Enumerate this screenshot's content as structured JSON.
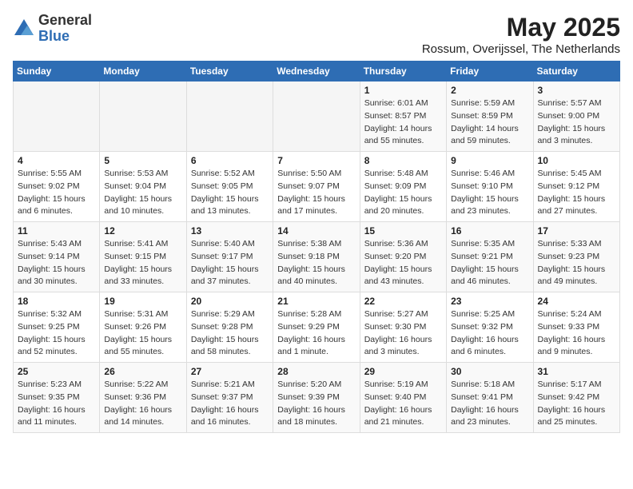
{
  "logo": {
    "general": "General",
    "blue": "Blue"
  },
  "title": {
    "month": "May 2025",
    "location": "Rossum, Overijssel, The Netherlands"
  },
  "days_of_week": [
    "Sunday",
    "Monday",
    "Tuesday",
    "Wednesday",
    "Thursday",
    "Friday",
    "Saturday"
  ],
  "weeks": [
    [
      {
        "day": "",
        "info": ""
      },
      {
        "day": "",
        "info": ""
      },
      {
        "day": "",
        "info": ""
      },
      {
        "day": "",
        "info": ""
      },
      {
        "day": "1",
        "info": "Sunrise: 6:01 AM\nSunset: 8:57 PM\nDaylight: 14 hours\nand 55 minutes."
      },
      {
        "day": "2",
        "info": "Sunrise: 5:59 AM\nSunset: 8:59 PM\nDaylight: 14 hours\nand 59 minutes."
      },
      {
        "day": "3",
        "info": "Sunrise: 5:57 AM\nSunset: 9:00 PM\nDaylight: 15 hours\nand 3 minutes."
      }
    ],
    [
      {
        "day": "4",
        "info": "Sunrise: 5:55 AM\nSunset: 9:02 PM\nDaylight: 15 hours\nand 6 minutes."
      },
      {
        "day": "5",
        "info": "Sunrise: 5:53 AM\nSunset: 9:04 PM\nDaylight: 15 hours\nand 10 minutes."
      },
      {
        "day": "6",
        "info": "Sunrise: 5:52 AM\nSunset: 9:05 PM\nDaylight: 15 hours\nand 13 minutes."
      },
      {
        "day": "7",
        "info": "Sunrise: 5:50 AM\nSunset: 9:07 PM\nDaylight: 15 hours\nand 17 minutes."
      },
      {
        "day": "8",
        "info": "Sunrise: 5:48 AM\nSunset: 9:09 PM\nDaylight: 15 hours\nand 20 minutes."
      },
      {
        "day": "9",
        "info": "Sunrise: 5:46 AM\nSunset: 9:10 PM\nDaylight: 15 hours\nand 23 minutes."
      },
      {
        "day": "10",
        "info": "Sunrise: 5:45 AM\nSunset: 9:12 PM\nDaylight: 15 hours\nand 27 minutes."
      }
    ],
    [
      {
        "day": "11",
        "info": "Sunrise: 5:43 AM\nSunset: 9:14 PM\nDaylight: 15 hours\nand 30 minutes."
      },
      {
        "day": "12",
        "info": "Sunrise: 5:41 AM\nSunset: 9:15 PM\nDaylight: 15 hours\nand 33 minutes."
      },
      {
        "day": "13",
        "info": "Sunrise: 5:40 AM\nSunset: 9:17 PM\nDaylight: 15 hours\nand 37 minutes."
      },
      {
        "day": "14",
        "info": "Sunrise: 5:38 AM\nSunset: 9:18 PM\nDaylight: 15 hours\nand 40 minutes."
      },
      {
        "day": "15",
        "info": "Sunrise: 5:36 AM\nSunset: 9:20 PM\nDaylight: 15 hours\nand 43 minutes."
      },
      {
        "day": "16",
        "info": "Sunrise: 5:35 AM\nSunset: 9:21 PM\nDaylight: 15 hours\nand 46 minutes."
      },
      {
        "day": "17",
        "info": "Sunrise: 5:33 AM\nSunset: 9:23 PM\nDaylight: 15 hours\nand 49 minutes."
      }
    ],
    [
      {
        "day": "18",
        "info": "Sunrise: 5:32 AM\nSunset: 9:25 PM\nDaylight: 15 hours\nand 52 minutes."
      },
      {
        "day": "19",
        "info": "Sunrise: 5:31 AM\nSunset: 9:26 PM\nDaylight: 15 hours\nand 55 minutes."
      },
      {
        "day": "20",
        "info": "Sunrise: 5:29 AM\nSunset: 9:28 PM\nDaylight: 15 hours\nand 58 minutes."
      },
      {
        "day": "21",
        "info": "Sunrise: 5:28 AM\nSunset: 9:29 PM\nDaylight: 16 hours\nand 1 minute."
      },
      {
        "day": "22",
        "info": "Sunrise: 5:27 AM\nSunset: 9:30 PM\nDaylight: 16 hours\nand 3 minutes."
      },
      {
        "day": "23",
        "info": "Sunrise: 5:25 AM\nSunset: 9:32 PM\nDaylight: 16 hours\nand 6 minutes."
      },
      {
        "day": "24",
        "info": "Sunrise: 5:24 AM\nSunset: 9:33 PM\nDaylight: 16 hours\nand 9 minutes."
      }
    ],
    [
      {
        "day": "25",
        "info": "Sunrise: 5:23 AM\nSunset: 9:35 PM\nDaylight: 16 hours\nand 11 minutes."
      },
      {
        "day": "26",
        "info": "Sunrise: 5:22 AM\nSunset: 9:36 PM\nDaylight: 16 hours\nand 14 minutes."
      },
      {
        "day": "27",
        "info": "Sunrise: 5:21 AM\nSunset: 9:37 PM\nDaylight: 16 hours\nand 16 minutes."
      },
      {
        "day": "28",
        "info": "Sunrise: 5:20 AM\nSunset: 9:39 PM\nDaylight: 16 hours\nand 18 minutes."
      },
      {
        "day": "29",
        "info": "Sunrise: 5:19 AM\nSunset: 9:40 PM\nDaylight: 16 hours\nand 21 minutes."
      },
      {
        "day": "30",
        "info": "Sunrise: 5:18 AM\nSunset: 9:41 PM\nDaylight: 16 hours\nand 23 minutes."
      },
      {
        "day": "31",
        "info": "Sunrise: 5:17 AM\nSunset: 9:42 PM\nDaylight: 16 hours\nand 25 minutes."
      }
    ]
  ]
}
